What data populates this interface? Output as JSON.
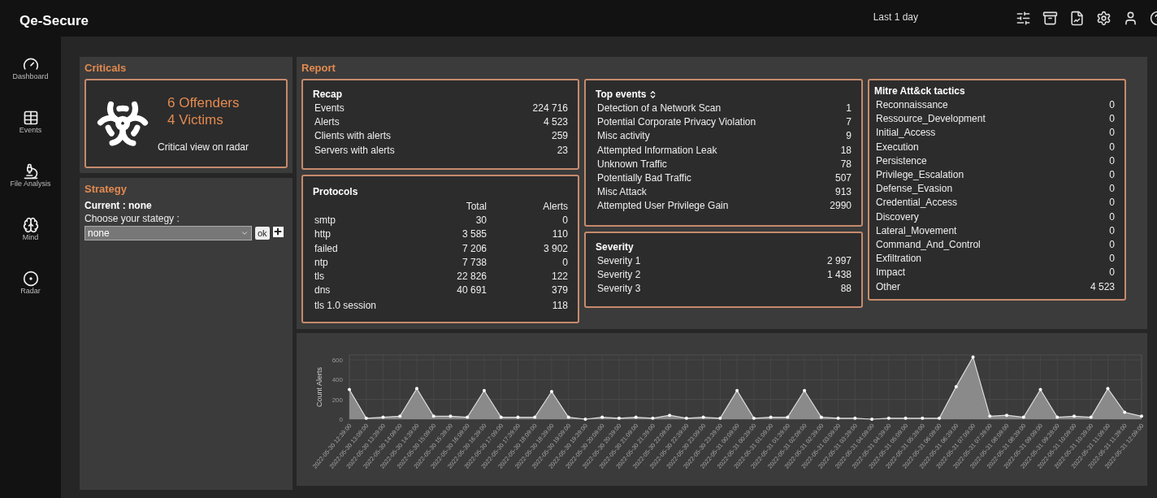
{
  "app": {
    "title": "Qe-Secure",
    "period": "Last 1 day"
  },
  "sidebar": {
    "items": [
      {
        "label": "Dashboard",
        "kind": "gauge"
      },
      {
        "label": "Events",
        "kind": "table"
      },
      {
        "label": "File Analysis",
        "kind": "microscope"
      },
      {
        "label": "Mind",
        "kind": "brain"
      },
      {
        "label": "Radar",
        "kind": "target"
      }
    ]
  },
  "criticals": {
    "title": "Criticals",
    "offenders": "6 Offenders",
    "victims": "4 Victims",
    "link": "Critical view on radar"
  },
  "strategy": {
    "title": "Strategy",
    "current": "Current : none",
    "prompt": "Choose your stategy :",
    "select": {
      "value": "none"
    },
    "ok": "ok"
  },
  "report": {
    "title": "Report",
    "recap": {
      "title": "Recap",
      "rows": [
        {
          "label": "Events",
          "value": "224 716"
        },
        {
          "label": "Alerts",
          "value": "4 523"
        },
        {
          "label": "Clients with alerts",
          "value": "259"
        },
        {
          "label": "Servers with alerts",
          "value": "23"
        }
      ]
    },
    "protocols": {
      "title": "Protocols",
      "columns": [
        "Total",
        "Alerts"
      ],
      "rows": [
        {
          "label": "smtp",
          "total": "30",
          "alerts": "0"
        },
        {
          "label": "http",
          "total": "3 585",
          "alerts": "110"
        },
        {
          "label": "failed",
          "total": "7 206",
          "alerts": "3 902"
        },
        {
          "label": "ntp",
          "total": "7 738",
          "alerts": "0"
        },
        {
          "label": "tls",
          "total": "22 826",
          "alerts": "122"
        },
        {
          "label": "dns",
          "total": "40 691",
          "alerts": "379"
        },
        {
          "label": "tls 1.0 session",
          "alerts": "118"
        }
      ]
    },
    "top_events": {
      "title": "Top events",
      "rows": [
        {
          "label": "Detection of a Network Scan",
          "value": "1"
        },
        {
          "label": "Potential Corporate Privacy Violation",
          "value": "7"
        },
        {
          "label": "Misc activity",
          "value": "9"
        },
        {
          "label": "Attempted Information Leak",
          "value": "18"
        },
        {
          "label": "Unknown Traffic",
          "value": "78"
        },
        {
          "label": "Potentially Bad Traffic",
          "value": "507"
        },
        {
          "label": "Misc Attack",
          "value": "913"
        },
        {
          "label": "Attempted User Privilege Gain",
          "value": "2990"
        }
      ]
    },
    "severity": {
      "title": "Severity",
      "rows": [
        {
          "label": "Severity 1",
          "value": "2 997"
        },
        {
          "label": "Severity 2",
          "value": "1 438"
        },
        {
          "label": "Severity 3",
          "value": "88"
        }
      ]
    },
    "mitre": {
      "title": "Mitre Att&ck tactics",
      "rows": [
        {
          "label": "Reconnaissance",
          "value": "0"
        },
        {
          "label": "Ressource_Development",
          "value": "0"
        },
        {
          "label": "Initial_Access",
          "value": "0"
        },
        {
          "label": "Execution",
          "value": "0"
        },
        {
          "label": "Persistence",
          "value": "0"
        },
        {
          "label": "Privilege_Escalation",
          "value": "0"
        },
        {
          "label": "Defense_Evasion",
          "value": "0"
        },
        {
          "label": "Credential_Access",
          "value": "0"
        },
        {
          "label": "Discovery",
          "value": "0"
        },
        {
          "label": "Lateral_Movement",
          "value": "0"
        },
        {
          "label": "Command_And_Control",
          "value": "0"
        },
        {
          "label": "Exfiltration",
          "value": "0"
        },
        {
          "label": "Impact",
          "value": "0"
        },
        {
          "label": "Other",
          "value": "4 523"
        }
      ]
    }
  },
  "alerts_chart": {
    "chart_data": {
      "type": "area",
      "ylabel": "Count Alerts",
      "grid": true,
      "ylim": [
        0,
        650
      ],
      "yticks": [
        0,
        200,
        400,
        600
      ],
      "categories": [
        "2022-05-30 12:39:00",
        "2022-05-30 13:09:00",
        "2022-05-30 13:39:00",
        "2022-05-30 14:09:00",
        "2022-05-30 14:39:00",
        "2022-05-30 15:09:00",
        "2022-05-30 15:39:00",
        "2022-05-30 16:09:00",
        "2022-05-30 16:39:00",
        "2022-05-30 17:09:00",
        "2022-05-30 17:39:00",
        "2022-05-30 18:09:00",
        "2022-05-30 18:39:00",
        "2022-05-30 19:09:00",
        "2022-05-30 19:39:00",
        "2022-05-30 20:09:00",
        "2022-05-30 20:39:00",
        "2022-05-30 21:09:00",
        "2022-05-30 21:39:00",
        "2022-05-30 22:09:00",
        "2022-05-30 22:39:00",
        "2022-05-30 23:09:00",
        "2022-05-30 23:39:00",
        "2022-05-31 00:09:00",
        "2022-05-31 00:39:00",
        "2022-05-31 01:09:00",
        "2022-05-31 01:39:00",
        "2022-05-31 02:09:00",
        "2022-05-31 02:39:00",
        "2022-05-31 03:09:00",
        "2022-05-31 03:39:00",
        "2022-05-31 04:09:00",
        "2022-05-31 04:39:00",
        "2022-05-31 05:09:00",
        "2022-05-31 05:39:00",
        "2022-05-31 06:09:00",
        "2022-05-31 06:39:00",
        "2022-05-31 07:09:00",
        "2022-05-31 07:39:00",
        "2022-05-31 08:09:00",
        "2022-05-31 08:39:00",
        "2022-05-31 09:09:00",
        "2022-05-31 09:39:00",
        "2022-05-31 10:09:00",
        "2022-05-31 10:39:00",
        "2022-05-31 11:09:00",
        "2022-05-31 11:39:00",
        "2022-05-31 12:09:00"
      ],
      "series": [
        {
          "color": "#8a8a8a",
          "values": [
            300,
            10,
            20,
            30,
            310,
            30,
            30,
            20,
            290,
            20,
            20,
            20,
            280,
            20,
            0,
            20,
            10,
            20,
            10,
            40,
            10,
            20,
            10,
            290,
            10,
            20,
            20,
            290,
            20,
            10,
            10,
            0,
            10,
            10,
            10,
            10,
            330,
            630,
            30,
            40,
            20,
            300,
            20,
            30,
            20,
            310,
            70,
            30
          ]
        }
      ]
    }
  }
}
